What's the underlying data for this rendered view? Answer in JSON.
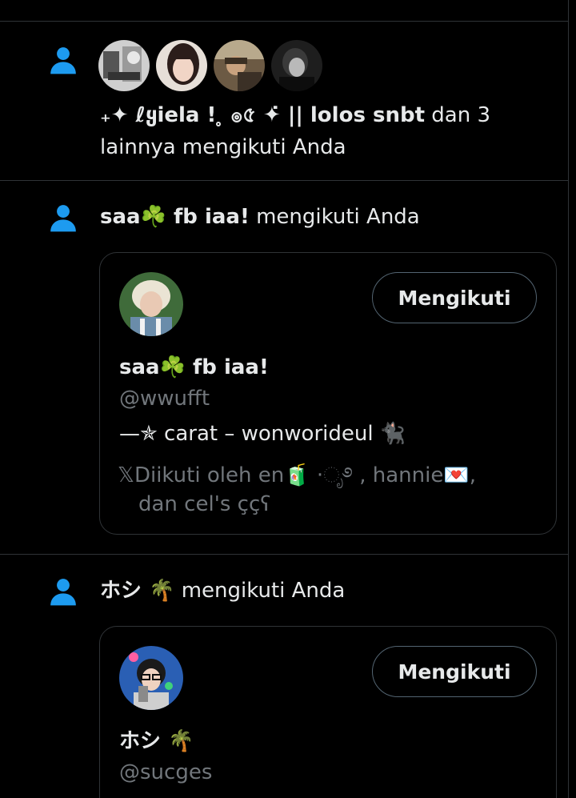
{
  "notifications": [
    {
      "icon": "person-icon",
      "avatars": [
        "avatar-1",
        "avatar-2",
        "avatar-3",
        "avatar-4"
      ],
      "actor": "₊✦ ℓყiela ! ̥ ၜ৫ ✦̇ || lolos snbt",
      "rest_line1": " dan 3",
      "rest_line2": "lainnya mengikuti Anda"
    },
    {
      "icon": "person-icon",
      "actor": "saa☘️ fb iaa!",
      "rest": " mengikuti Anda",
      "card": {
        "button": "Mengikuti",
        "name": "saa☘️ fb iaa!",
        "handle": "@wwufft",
        "bio": "—✯ carat – wonworideul 🐈‍⬛",
        "followed_line1": "𝕏Diikuti oleh en🧃 ·ೃ࿔ , hannie💌,",
        "followed_line2": "dan cel's ççʕ"
      }
    },
    {
      "icon": "person-icon",
      "actor": "ホシ 🌴",
      "rest": " mengikuti Anda",
      "card": {
        "button": "Mengikuti",
        "name": "ホシ 🌴",
        "handle": "@sucges"
      }
    }
  ],
  "colors": {
    "background": "#000000",
    "icon_blue": "#1d9bf0",
    "text": "#e7e9ea",
    "muted": "#71767b",
    "border": "#2f3336"
  }
}
